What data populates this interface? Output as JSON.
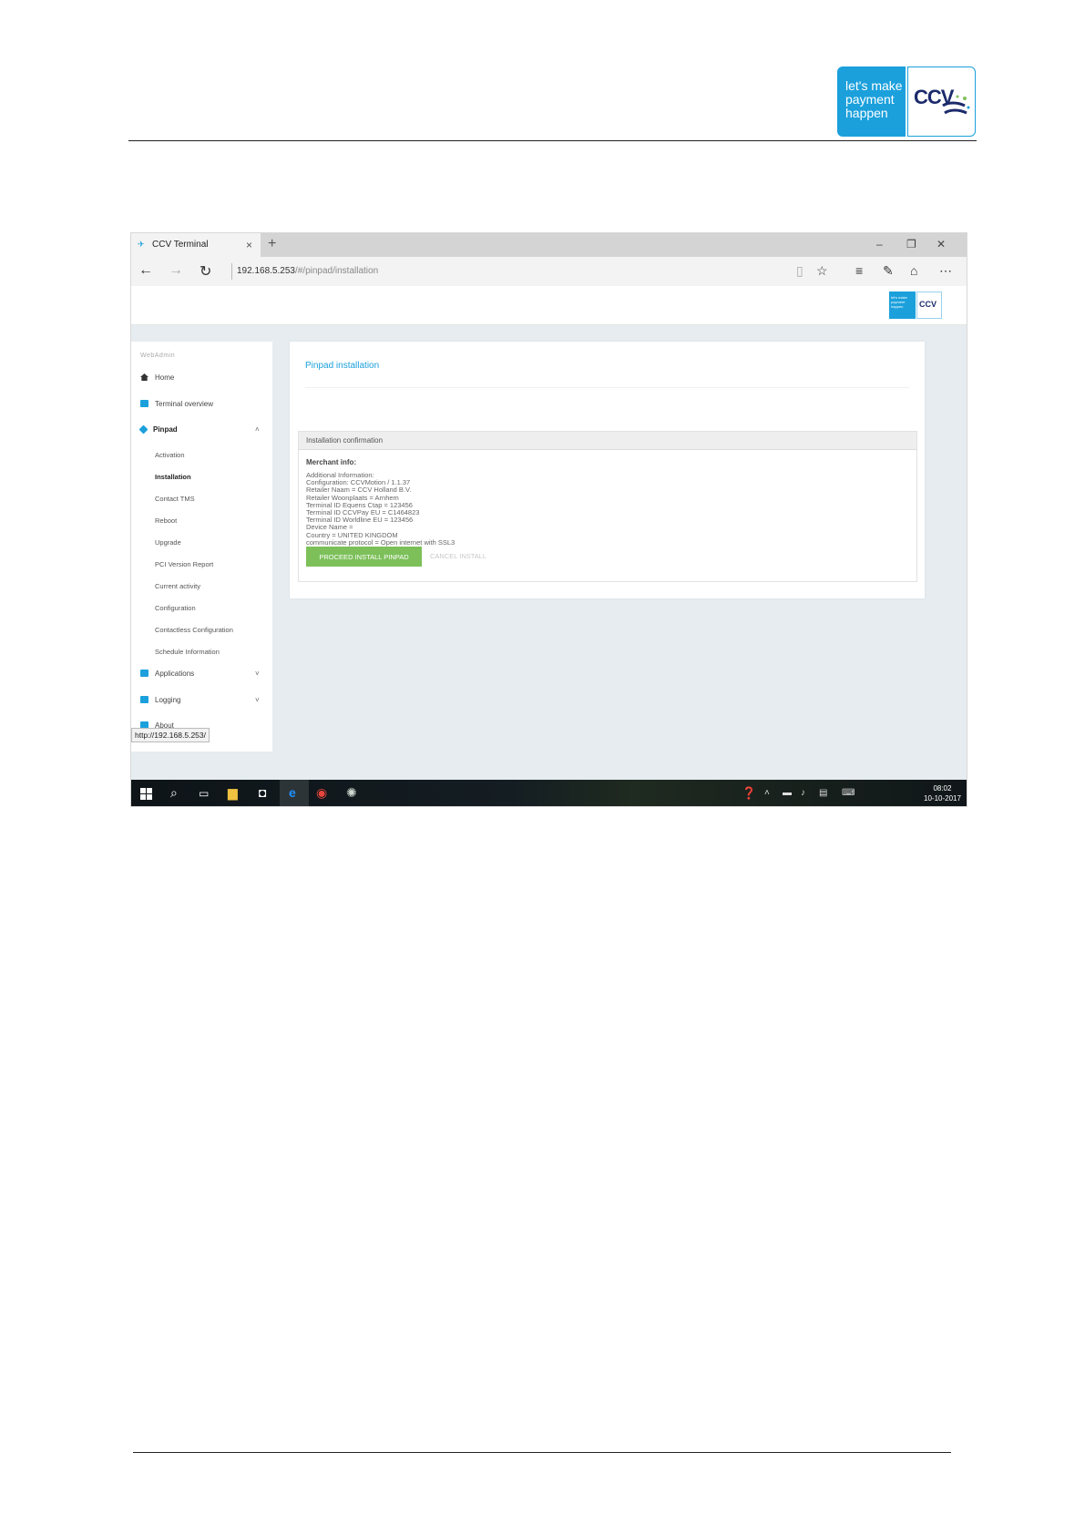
{
  "doc": {
    "logo_slogan": "let's make payment happen",
    "logo_brand": "CCV"
  },
  "browser": {
    "tab_title": "CCV Terminal",
    "tab_close": "×",
    "new_tab": "+",
    "minimize": "–",
    "restore": "❐",
    "close": "✕",
    "url_host": "192.168.5.253",
    "url_path": "/#/pinpad/installation",
    "status_url": "http://192.168.5.253/"
  },
  "app": {
    "mini_logo_slogan": "let's make payment happen",
    "mini_logo_brand": "CCV"
  },
  "sidebar": {
    "header": "WebAdmin",
    "home": "Home",
    "terminal_overview": "Terminal overview",
    "pinpad": "Pinpad",
    "pinpad_subitems": [
      "Activation",
      "Installation",
      "Contact TMS",
      "Reboot",
      "Upgrade",
      "PCI Version Report",
      "Current activity",
      "Configuration",
      "Contactless Configuration",
      "Schedule Information"
    ],
    "applications": "Applications",
    "logging": "Logging",
    "about": "About"
  },
  "main": {
    "title": "Pinpad installation",
    "panel_title": "Installation confirmation",
    "merchant_label": "Merchant info:",
    "info_lines": [
      "Additional Information:",
      "Configuration: CCVMotion / 1.1.37",
      "Retailer Naam = CCV Holland B.V.",
      "Retailer Woonplaats = Arnhem",
      "Terminal ID Equens Ctap = 123456",
      "Terminal ID CCVPay EU = C1464823",
      "Terminal ID Worldline EU = 123456",
      "Device Name =",
      "Country = UNITED KINGDOM",
      "communicate protocol = Open internet with SSL3"
    ],
    "proceed_button": "PROCEED INSTALL PINPAD",
    "cancel_button": "CANCEL INSTALL"
  },
  "taskbar": {
    "time": "08:02",
    "date": "10-10-2017"
  }
}
